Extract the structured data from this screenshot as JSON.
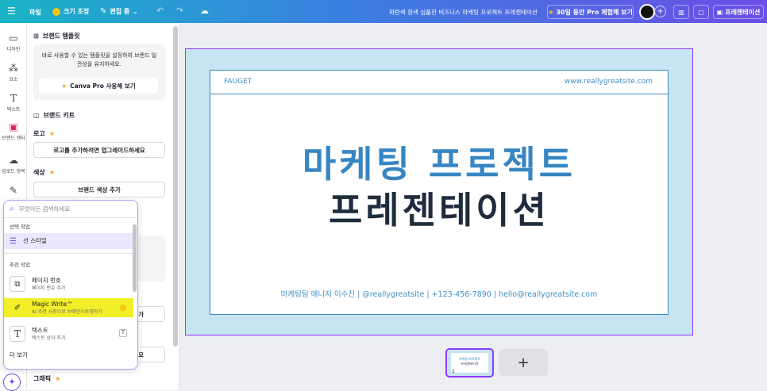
{
  "topbar": {
    "menu_icon": "hamburger-icon",
    "file": "파일",
    "resize": "크기 조정",
    "editing": "편집 중",
    "doc_title": "파란색 흰색 심플한 비즈니스 마케팅 프로젝트 프레젠테이션",
    "trial": "30일 동안 Pro 체험해 보기",
    "present": "프레젠테이션"
  },
  "sidebar": {
    "items": [
      {
        "label": "디자인",
        "icon": "design-icon"
      },
      {
        "label": "요소",
        "icon": "elements-icon"
      },
      {
        "label": "텍스트",
        "icon": "text-icon"
      },
      {
        "label": "브랜드 센터",
        "icon": "brand-icon"
      },
      {
        "label": "업로드 항목",
        "icon": "upload-icon"
      },
      {
        "label": "",
        "icon": "draw-icon"
      }
    ],
    "magic_icon": "magic-icon"
  },
  "panel": {
    "brand_templates_title": "브랜드 템플릿",
    "brand_templates_desc": "바로 사용할 수 있는 템플릿을 설정하여 브랜드 일관성을 유지하세요.",
    "canva_pro_btn": "Canva Pro 사용해 보기",
    "brand_kit_title": "브랜드 키트",
    "logo_label": "로고",
    "logo_btn": "로고를 추가하려면 업그레이드하세요",
    "color_label": "색상",
    "color_btn": "브랜드 색상 추가",
    "btn_partial_1": "가",
    "btn_partial_2": "요",
    "graphic_label": "그래픽"
  },
  "popup": {
    "search_placeholder": "무엇이든 검색하세요",
    "section_selected": "선택 작업",
    "line_style": "선 스타일",
    "section_recommended": "추천 작업",
    "items": [
      {
        "label": "페이지 번호",
        "sub": "페이지 번호 추가",
        "icon": "page-number-icon"
      },
      {
        "label": "Magic Write™",
        "sub": "AI 추천 사항으로 브레인스토밍하기",
        "icon": "magic-write-icon"
      },
      {
        "label": "텍스트",
        "sub": "텍스트 상자 추가",
        "icon": "text-box-icon",
        "shortcut": "T"
      }
    ],
    "more": "더 보기"
  },
  "slide": {
    "brand": "FAUGET",
    "url": "www.reallygreatsite.com",
    "title_line1": "마케팅 프로젝트",
    "title_line2": "프레젠테이션",
    "footer": "마케팅팀 매니저 이수진   |   @reallygreatsite   |   +123-456-7890   |   hello@reallygreatsite.com"
  },
  "thumbnail": {
    "page_number": "1",
    "line1": "마케팅 프로젝트",
    "line2": "프레젠테이션"
  },
  "add_page": "+",
  "colors": {
    "accent": "#8b3dff",
    "slide_bg": "#c8e3f2",
    "title_blue": "#3786c3",
    "title_dark": "#1f2c3d",
    "highlight": "#f2ee2a"
  }
}
